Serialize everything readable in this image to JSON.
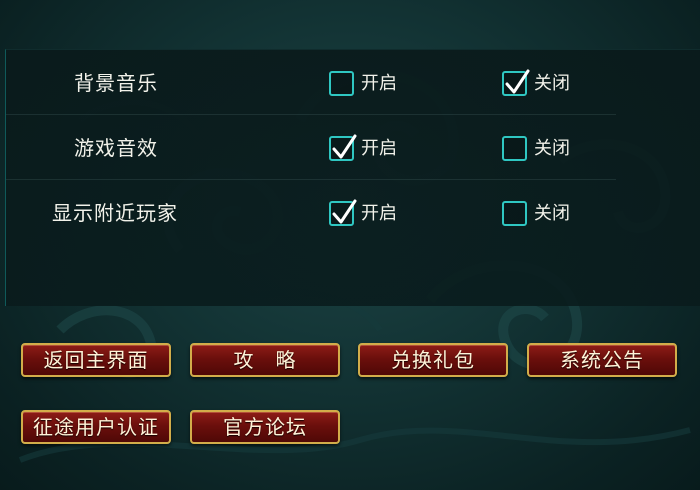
{
  "settings": {
    "rows": [
      {
        "label": "背景音乐",
        "on_label": "开启",
        "off_label": "关闭",
        "value": "off"
      },
      {
        "label": "游戏音效",
        "on_label": "开启",
        "off_label": "关闭",
        "value": "on"
      },
      {
        "label": "显示附近玩家",
        "on_label": "开启",
        "off_label": "关闭",
        "value": "on"
      }
    ]
  },
  "buttons": {
    "main_menu": "返回主界面",
    "guide": "攻　略",
    "redeem_gift": "兑换礼包",
    "announcement": "系统公告",
    "user_auth": "征途用户认证",
    "forum": "官方论坛"
  },
  "colors": {
    "background": "#123233",
    "checkbox_border": "#2fc7c2",
    "button_fill": "#7a1410",
    "button_border": "#d2ad4a",
    "text": "#f2f2ea"
  },
  "icons": {
    "checkmark": "check-icon",
    "background_decor": "cloud-pattern-icon"
  }
}
